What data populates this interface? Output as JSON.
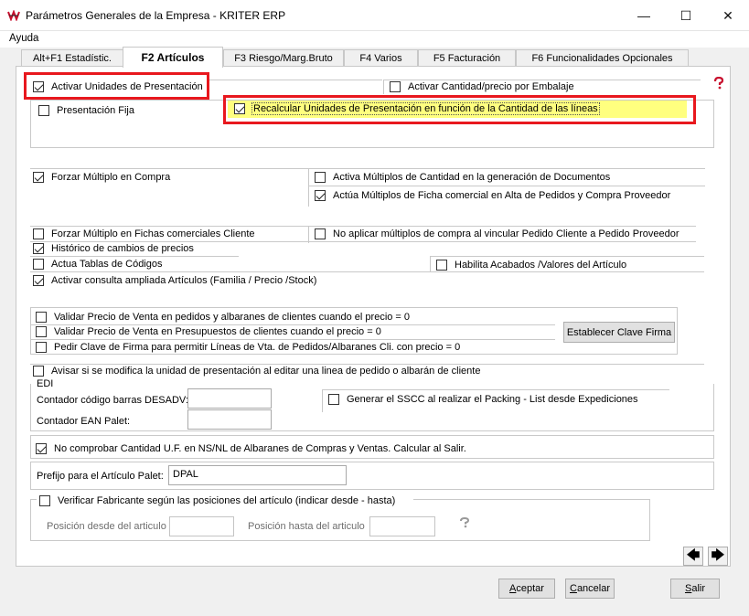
{
  "window": {
    "title": "Parámetros Generales de la Empresa - KRITER ERP",
    "minimize_glyph": "—",
    "maximize_glyph": "☐",
    "close_glyph": "✕"
  },
  "menu": {
    "items": [
      "Ayuda"
    ]
  },
  "tabs": [
    {
      "label": "Alt+F1 Estadístic.",
      "active": false
    },
    {
      "label": "F2 Artículos",
      "active": true
    },
    {
      "label": "F3 Riesgo/Marg.Bruto",
      "active": false
    },
    {
      "label": "F4 Varios",
      "active": false
    },
    {
      "label": "F5 Facturación",
      "active": false
    },
    {
      "label": "F6 Funcionalidades Opcionales",
      "active": false
    }
  ],
  "checkboxes": {
    "activar_unidades": {
      "label": "Activar Unidades de Presentación",
      "checked": true
    },
    "activar_cantidad_precio": {
      "label": "Activar Cantidad/precio por Embalaje",
      "checked": false
    },
    "presentacion_fija": {
      "label": "Presentación Fija",
      "checked": false
    },
    "recalcular": {
      "label": "Recalcular Unidades de Presentación en función de la Cantidad de las líneas",
      "checked": true
    },
    "forzar_multiplo_compra": {
      "label": "Forzar Múltiplo en Compra",
      "checked": true
    },
    "activa_multiplos": {
      "label": "Activa Múltiplos de Cantidad en la generación de  Documentos",
      "checked": false
    },
    "actua_multiplos": {
      "label": "Actúa Múltiplos de Ficha comercial en Alta de Pedidos y Compra Proveedor",
      "checked": true
    },
    "forzar_multiplo_fichas": {
      "label": "Forzar Múltiplo en Fichas comerciales Cliente",
      "checked": false
    },
    "no_aplicar_multiplos": {
      "label": "No aplicar múltiplos de compra al vincular Pedido Cliente a Pedido Proveedor",
      "checked": false
    },
    "historico_precios": {
      "label": "Histórico de cambios de precios",
      "checked": true
    },
    "actua_tablas": {
      "label": "Actua Tablas de Códigos",
      "checked": false
    },
    "habilita_acabados": {
      "label": "Habilita Acabados /Valores del Artículo",
      "checked": false
    },
    "consulta_ampliada": {
      "label": "Activar consulta ampliada Artículos (Familia / Precio /Stock)",
      "checked": true
    },
    "validar_pedidos": {
      "label": "Validar Precio de Venta en pedidos y albaranes de clientes cuando el precio = 0",
      "checked": false
    },
    "validar_presupuestos": {
      "label": "Validar Precio de Venta en Presupuestos de clientes cuando el precio = 0",
      "checked": false
    },
    "pedir_clave": {
      "label": "Pedir Clave de Firma para permitir Líneas de Vta. de Pedidos/Albaranes Cli. con precio = 0",
      "checked": false
    },
    "avisar_unidad": {
      "label": "Avisar si se modifica la unidad de presentación al editar una linea de pedido o albarán de cliente",
      "checked": false
    },
    "generar_sscc": {
      "label": "Generar el SSCC al realizar el Packing - List desde Expediciones",
      "checked": false
    },
    "no_comprobar": {
      "label": "No comprobar Cantidad U.F. en NS/NL de Albaranes de Compras y Ventas. Calcular al Salir.",
      "checked": true
    },
    "verificar_fabricante": {
      "label": "Verificar Fabricante según las posiciones del artículo (indicar desde - hasta)",
      "checked": false
    }
  },
  "buttons": {
    "establecer_clave": "Establecer Clave Firma",
    "aceptar_rest": "ceptar",
    "aceptar_key": "A",
    "cancelar_rest": "ancelar",
    "cancelar_key": "C",
    "salir_rest": "alir",
    "salir_key": "S",
    "prev_glyph": "🡄",
    "next_glyph": "🡆"
  },
  "edi": {
    "legend": "EDI",
    "contador_desadv_label": "Contador código barras DESADV:",
    "contador_desadv_value": "",
    "contador_ean_label": "Contador EAN Palet:",
    "contador_ean_value": ""
  },
  "prefijo": {
    "label": "Prefijo para el Artículo Palet:",
    "value": "DPAL"
  },
  "posiciones": {
    "desde_label": "Posición desde del articulo",
    "desde_value": "",
    "hasta_label": "Posición hasta del articulo",
    "hasta_value": ""
  },
  "icons": {
    "help": "help-question-icon",
    "app": "kriter-app-icon"
  },
  "colors": {
    "highlight_red": "#e8181e",
    "highlight_yellow": "#ffff7f"
  }
}
